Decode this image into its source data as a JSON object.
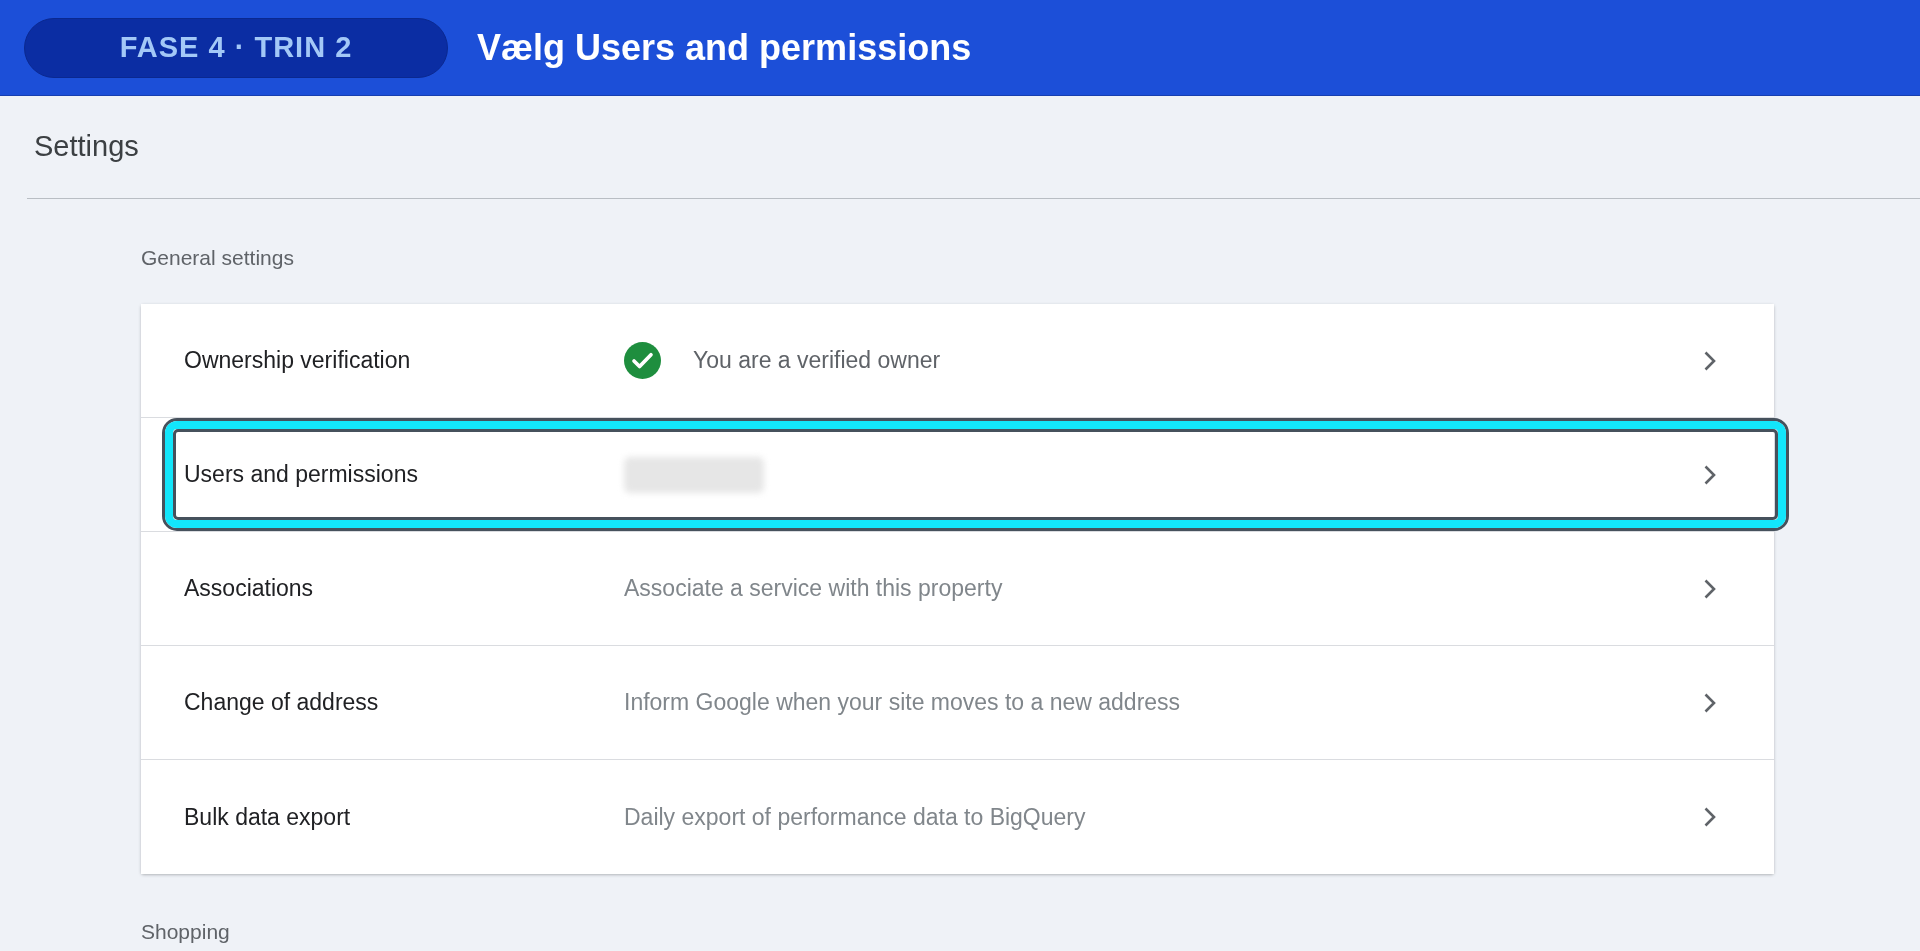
{
  "banner": {
    "step": "FASE 4 · TRIN 2",
    "title": "Vælg Users and permissions"
  },
  "page": {
    "title": "Settings"
  },
  "sections": [
    {
      "heading": "General settings",
      "rows": [
        {
          "label": "Ownership verification",
          "kind": "verified",
          "description": "You are a verified owner",
          "highlighted": false
        },
        {
          "label": "Users and permissions",
          "kind": "redacted",
          "highlighted": true
        },
        {
          "label": "Associations",
          "kind": "text",
          "description": "Associate a service with this property",
          "highlighted": false
        },
        {
          "label": "Change of address",
          "kind": "text",
          "description": "Inform Google when your site moves to a new address",
          "highlighted": false
        },
        {
          "label": "Bulk data export",
          "kind": "text",
          "description": "Daily export of performance data to BigQuery",
          "highlighted": false
        }
      ]
    },
    {
      "heading": "Shopping"
    }
  ]
}
